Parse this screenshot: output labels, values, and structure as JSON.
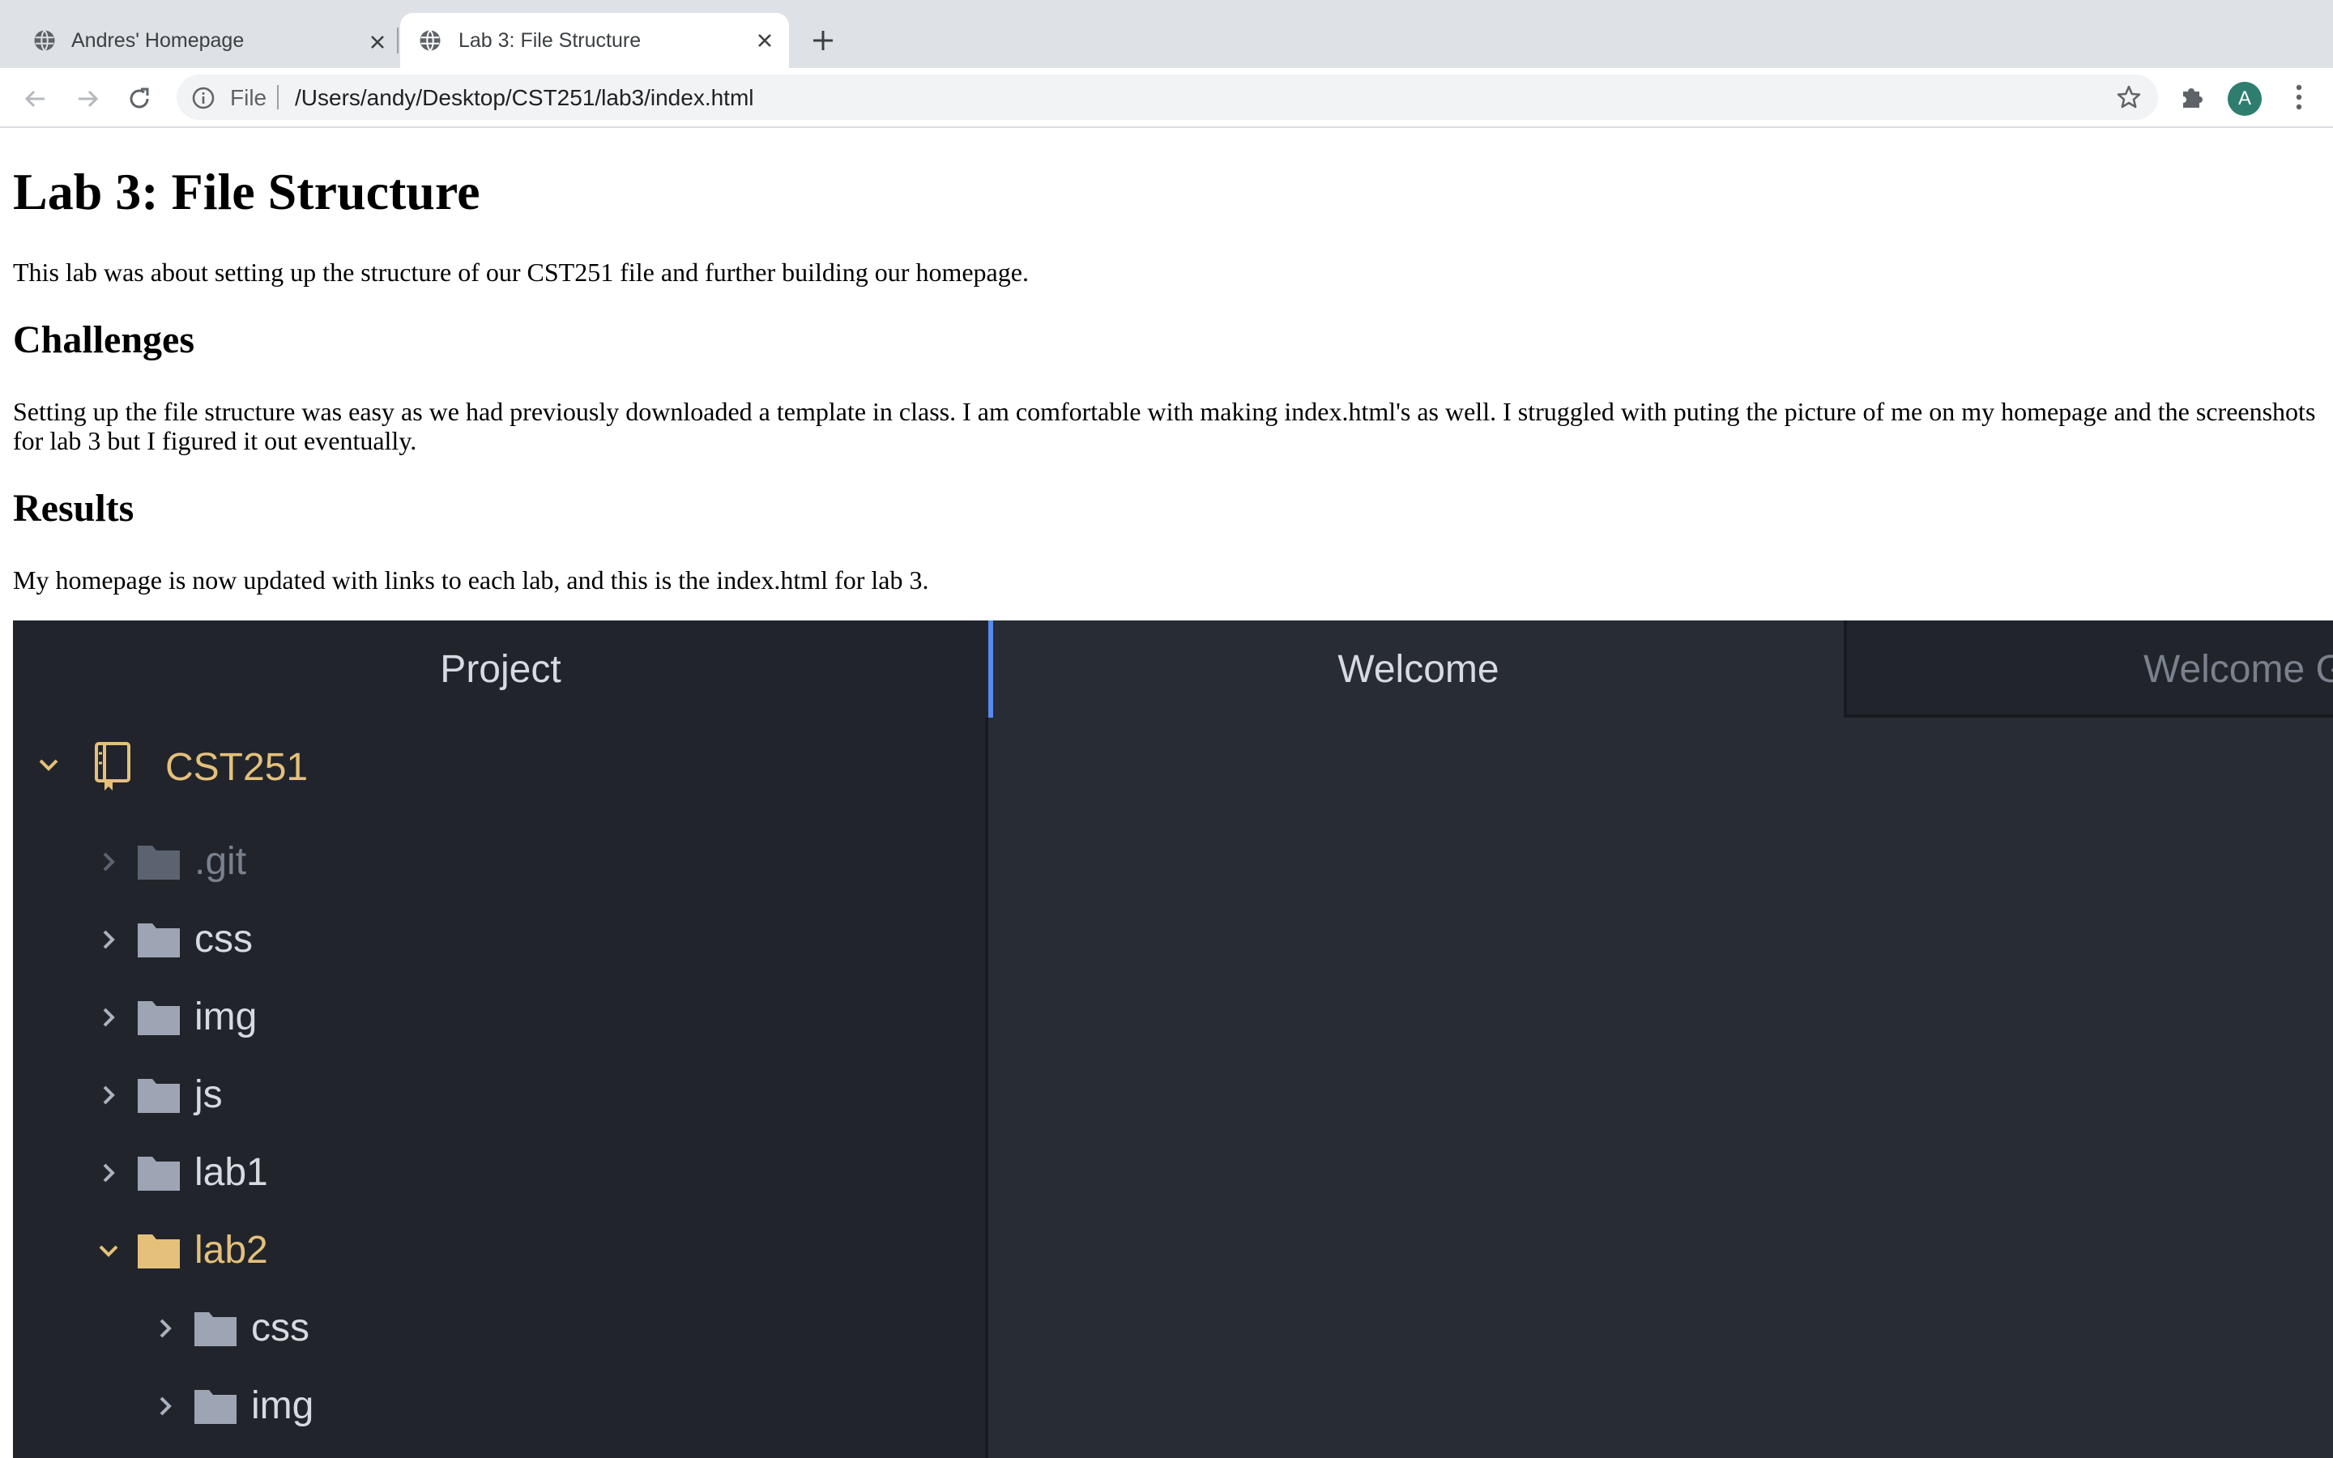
{
  "browser": {
    "tabs": [
      {
        "title": "Andres' Homepage",
        "active": false
      },
      {
        "title": "Lab 3: File Structure",
        "active": true
      }
    ],
    "address_bar": {
      "scheme_label": "File",
      "url": "/Users/andy/Desktop/CST251/lab3/index.html"
    },
    "profile_initial": "A",
    "colors": {
      "avatar": "#2e7d6e",
      "tabstrip": "#dee1e6"
    }
  },
  "page": {
    "title": "Lab 3: File Structure",
    "intro": "This lab was about setting up the structure of our CST251 file and further building our homepage.",
    "challenges_heading": "Challenges",
    "challenges_text": "Setting up the file structure was easy as we had previously downloaded a template in class. I am comfortable with making index.html's as well. I struggled with puting the picture of me on my homepage and the screenshots for lab 3 but I figured it out eventually.",
    "results_heading": "Results",
    "results_text": "My homepage is now updated with links to each lab, and this is the index.html for lab 3."
  },
  "screenshot": {
    "tabs": [
      "Project",
      "Welcome",
      "Welcome G"
    ],
    "tree": [
      {
        "label": "CST251",
        "type": "project",
        "expanded": true
      },
      {
        "label": ".git",
        "type": "folder",
        "expanded": false,
        "dimmed": true
      },
      {
        "label": "css",
        "type": "folder",
        "expanded": false
      },
      {
        "label": "img",
        "type": "folder",
        "expanded": false
      },
      {
        "label": "js",
        "type": "folder",
        "expanded": false
      },
      {
        "label": "lab1",
        "type": "folder",
        "expanded": false
      },
      {
        "label": "lab2",
        "type": "folder",
        "expanded": true
      },
      {
        "label": "css",
        "type": "folder",
        "expanded": false
      },
      {
        "label": "img",
        "type": "folder",
        "expanded": false
      }
    ],
    "colors": {
      "accent": "#568af2",
      "highlight": "#e5c07b",
      "text": "#d7dae0",
      "dim": "#7a818c"
    }
  }
}
